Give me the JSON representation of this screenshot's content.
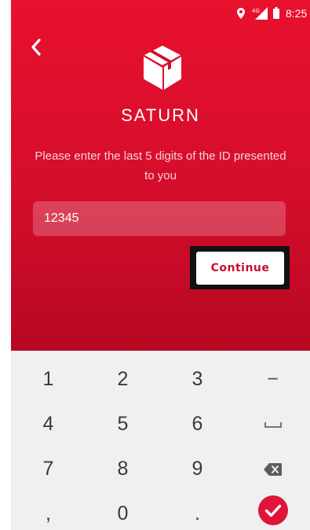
{
  "status_bar": {
    "time": "8:25",
    "icons": [
      "location-icon",
      "signal-4g-icon",
      "battery-icon"
    ],
    "network": "4G"
  },
  "header": {
    "back_icon": "chevron-left-icon",
    "logo_icon": "saturn-box-logo",
    "brand": "SATURN"
  },
  "form": {
    "prompt": "Please enter the last 5 digits of the ID presented to you",
    "id_value": "12345",
    "continue_label": "Continue"
  },
  "keypad": {
    "keys": [
      [
        "1",
        "2",
        "3",
        "−"
      ],
      [
        "4",
        "5",
        "6",
        "space"
      ],
      [
        "7",
        "8",
        "9",
        "backspace"
      ],
      [
        ",",
        "0",
        ".",
        "done"
      ]
    ]
  },
  "colors": {
    "brand_red": "#d40d2c",
    "keypad_bg": "#eef0f1",
    "done_key": "#e0143a"
  }
}
